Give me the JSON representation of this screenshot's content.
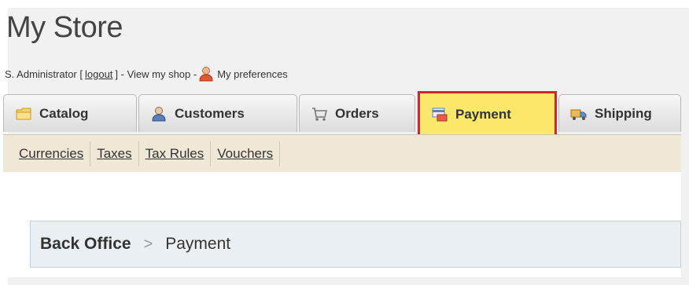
{
  "header": {
    "store_name": "My Store",
    "admin_name": "S. Administrator [",
    "logout_label": "logout",
    "after_logout": "] - View my shop -",
    "preferences_label": "My preferences"
  },
  "tabs": [
    {
      "label": "Catalog",
      "icon": "folder-icon"
    },
    {
      "label": "Customers",
      "icon": "customers-icon"
    },
    {
      "label": "Orders",
      "icon": "cart-icon"
    },
    {
      "label": "Payment",
      "icon": "payment-icon",
      "active": true
    },
    {
      "label": "Shipping",
      "icon": "truck-icon"
    }
  ],
  "subnav": [
    "Currencies",
    "Taxes",
    "Tax Rules",
    "Vouchers"
  ],
  "breadcrumb": {
    "home": "Back Office",
    "separator": ">",
    "current": "Payment"
  },
  "colors": {
    "active_tab_bg": "#fbe76a",
    "active_tab_border": "#d7242b",
    "subnav_bg": "#efe8d6",
    "breadcrumb_bg": "#e9eff3"
  }
}
